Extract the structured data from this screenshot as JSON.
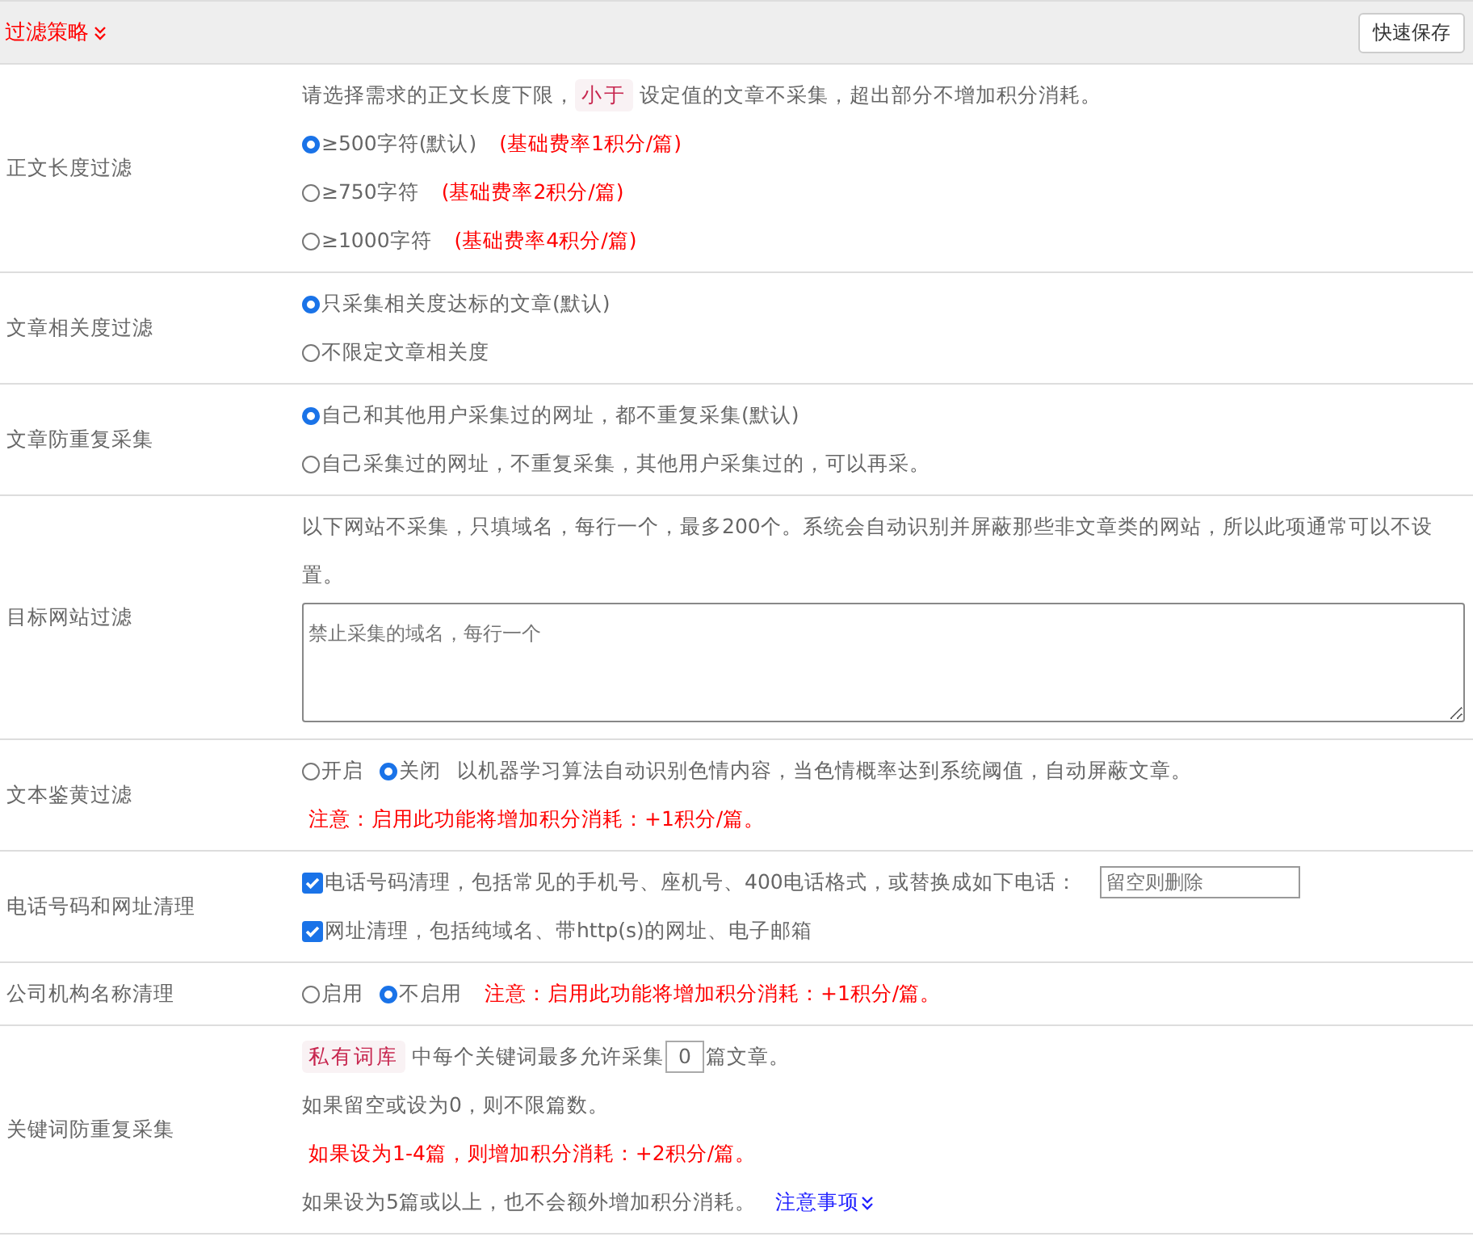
{
  "header": {
    "title": "过滤策略",
    "button": "快速保存"
  },
  "rows": [
    {
      "label": "正文长度过滤",
      "lines": [
        [
          {
            "kind": "text",
            "text": "请选择需求的正文长度下限，"
          },
          {
            "kind": "tag",
            "text": "小于"
          },
          {
            "kind": "text",
            "text": "设定值的文章不采集，超出部分不增加积分消耗。"
          }
        ],
        [
          {
            "kind": "radio",
            "text": "≥500字符(默认)",
            "selected": true
          },
          {
            "kind": "red",
            "text": "(基础费率1积分/篇)"
          }
        ],
        [
          {
            "kind": "radio",
            "text": "≥750字符",
            "selected": false
          },
          {
            "kind": "red",
            "text": "(基础费率2积分/篇)"
          }
        ],
        [
          {
            "kind": "radio",
            "text": "≥1000字符",
            "selected": false
          },
          {
            "kind": "red",
            "text": "(基础费率4积分/篇)"
          }
        ]
      ]
    },
    {
      "label": "文章相关度过滤",
      "lines": [
        [
          {
            "kind": "radio",
            "text": "只采集相关度达标的文章(默认)",
            "selected": true
          }
        ],
        [
          {
            "kind": "radio",
            "text": "不限定文章相关度",
            "selected": false
          }
        ]
      ]
    },
    {
      "label": "文章防重复采集",
      "lines": [
        [
          {
            "kind": "radio",
            "text": "自己和其他用户采集过的网址，都不重复采集(默认)",
            "selected": true
          }
        ],
        [
          {
            "kind": "radio",
            "text": "自己采集过的网址，不重复采集，其他用户采集过的，可以再采。",
            "selected": false
          }
        ]
      ]
    },
    {
      "label": "目标网站过滤",
      "lines": [
        [
          {
            "kind": "text",
            "text": "以下网站不采集，只填域名，每行一个，最多200个。系统会自动识别并屏蔽那些非文章类的网站，所以此项通常可以不设置。"
          }
        ],
        [
          {
            "kind": "textarea",
            "placeholder": "禁止采集的域名，每行一个"
          }
        ]
      ]
    },
    {
      "label": "文本鉴黄过滤",
      "lines": [
        [
          {
            "kind": "radio",
            "text": "开启",
            "selected": false
          },
          {
            "kind": "radio",
            "text": "关闭",
            "selected": true
          },
          {
            "kind": "text",
            "text": "以机器学习算法自动识别色情内容，当色情概率达到系统阈值，自动屏蔽文章。"
          }
        ],
        [
          {
            "kind": "red",
            "text": "注意：启用此功能将增加积分消耗：+1积分/篇。"
          }
        ]
      ]
    },
    {
      "label": "电话号码和网址清理",
      "lines": [
        [
          {
            "kind": "checkbox",
            "text": "电话号码清理，包括常见的手机号、座机号、400电话格式，或替换成如下电话：",
            "checked": true
          },
          {
            "kind": "input",
            "placeholder": "留空则删除"
          }
        ],
        [
          {
            "kind": "checkbox",
            "text": "网址清理，包括纯域名、带http(s)的网址、电子邮箱",
            "checked": true
          }
        ]
      ]
    },
    {
      "label": "公司机构名称清理",
      "lines": [
        [
          {
            "kind": "radio",
            "text": "启用",
            "selected": false
          },
          {
            "kind": "radio",
            "text": "不启用",
            "selected": true
          },
          {
            "kind": "red",
            "text": "注意：启用此功能将增加积分消耗：+1积分/篇。"
          }
        ]
      ]
    },
    {
      "label": "关键词防重复采集",
      "lines": [
        [
          {
            "kind": "tag",
            "text": "私有词库"
          },
          {
            "kind": "text",
            "text": "中每个关键词最多允许采集"
          },
          {
            "kind": "number",
            "value": "0"
          },
          {
            "kind": "text",
            "text": "篇文章。"
          }
        ],
        [
          {
            "kind": "text",
            "text": "如果留空或设为0，则不限篇数。"
          }
        ],
        [
          {
            "kind": "red",
            "text": "如果设为1-4篇，则增加积分消耗：+2积分/篇。"
          }
        ],
        [
          {
            "kind": "text",
            "text": "如果设为5篇或以上，也不会额外增加积分消耗。"
          },
          {
            "kind": "link",
            "text": "注意事项"
          }
        ]
      ]
    }
  ]
}
